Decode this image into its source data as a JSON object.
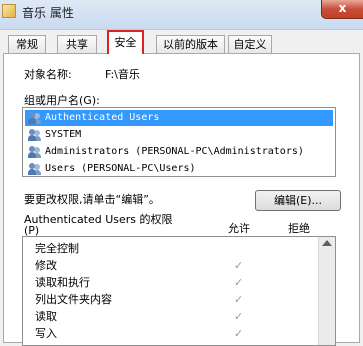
{
  "window": {
    "title": "音乐 属性",
    "close_label": "x"
  },
  "tabs": [
    "常规",
    "共享",
    "安全",
    "以前的版本",
    "自定义"
  ],
  "object": {
    "label": "对象名称:",
    "value": "F:\\音乐"
  },
  "groups": {
    "label": "组或用户名(G):",
    "items": [
      "Authenticated Users",
      "SYSTEM",
      "Administrators (PERSONAL-PC\\Administrators)",
      "Users (PERSONAL-PC\\Users)"
    ]
  },
  "change_hint": "要更改权限,请单击“编辑”。",
  "edit_button": "编辑(E)...",
  "permissions": {
    "header_line1": "Authenticated Users 的权限",
    "header_line2": "(P)",
    "allow": "允许",
    "deny": "拒绝",
    "items": [
      "完全控制",
      "修改",
      "读取和执行",
      "列出文件夹内容",
      "读取",
      "写入"
    ],
    "allow_checked": [
      false,
      true,
      true,
      true,
      true,
      true
    ]
  }
}
